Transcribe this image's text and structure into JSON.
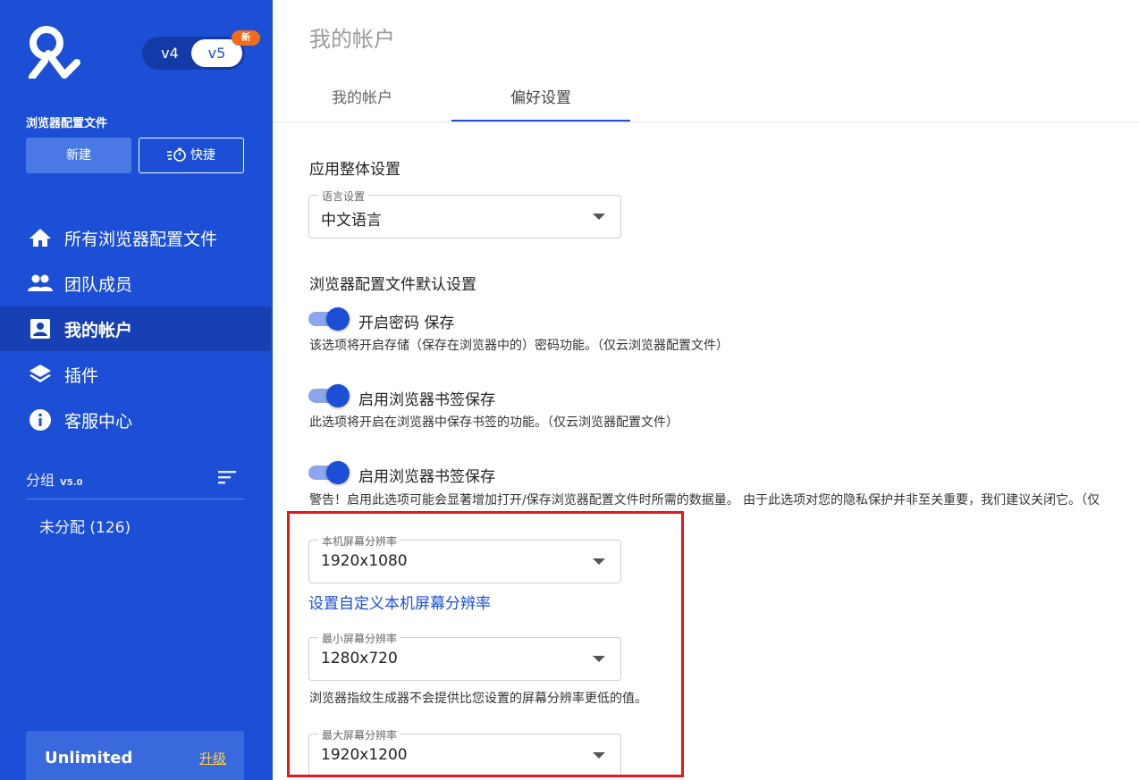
{
  "sidebar": {
    "version_toggle": {
      "v4": "v4",
      "v5": "v5",
      "badge": "新"
    },
    "profiles_title": "浏览器配置文件",
    "new_button": "新建",
    "quick_button": "快捷",
    "nav": [
      {
        "label": "所有浏览器配置文件",
        "icon": "home-icon"
      },
      {
        "label": "团队成员",
        "icon": "people-icon"
      },
      {
        "label": "我的帐户",
        "icon": "account-box-icon",
        "active": true
      },
      {
        "label": "插件",
        "icon": "layers-icon"
      },
      {
        "label": "客服中心",
        "icon": "info-icon"
      }
    ],
    "group_title": "分组",
    "group_version": "V5.0",
    "group_item": "未分配 (126)",
    "plan_name": "Unlimited",
    "plan_upgrade": "升级"
  },
  "main": {
    "page_title": "我的帐户",
    "tabs": [
      {
        "label": "我的帐户"
      },
      {
        "label": "偏好设置",
        "active": true
      }
    ],
    "general_title": "应用整体设置",
    "language": {
      "label": "语言设置",
      "value": "中文语言"
    },
    "profile_defaults_title": "浏览器配置文件默认设置",
    "toggles": [
      {
        "label": "开启密码 保存",
        "enabled": true,
        "desc": "该选项将开启存储（保存在浏览器中的）密码功能。（仅云浏览器配置文件）"
      },
      {
        "label": "启用浏览器书签保存",
        "enabled": true,
        "desc": "此选项将开启在浏览器中保存书签的功能。（仅云浏览器配置文件）"
      },
      {
        "label": "启用浏览器书签保存",
        "enabled": true,
        "desc": "警告！启用此选项可能会显著增加打开/保存浏览器配置文件时所需的数据量。 由于此选项对您的隐私保护并非至关重要，我们建议关闭它。（仅"
      }
    ],
    "local_resolution": {
      "label": "本机屏幕分辨率",
      "value": "1920x1080"
    },
    "custom_resolution_link": "设置自定义本机屏幕分辨率",
    "min_resolution": {
      "label": "最小屏幕分辨率",
      "value": "1280x720"
    },
    "min_resolution_desc": "浏览器指纹生成器不会提供比您设置的屏幕分辨率更低的值。",
    "max_resolution": {
      "label": "最大屏幕分辨率",
      "value": "1920x1200"
    }
  },
  "colors": {
    "sidebar_bg": "#1c4fd6",
    "accent": "#1c4fd6",
    "badge": "#f26a1b",
    "upgrade": "#ffd23f",
    "highlight": "#e8161b"
  }
}
